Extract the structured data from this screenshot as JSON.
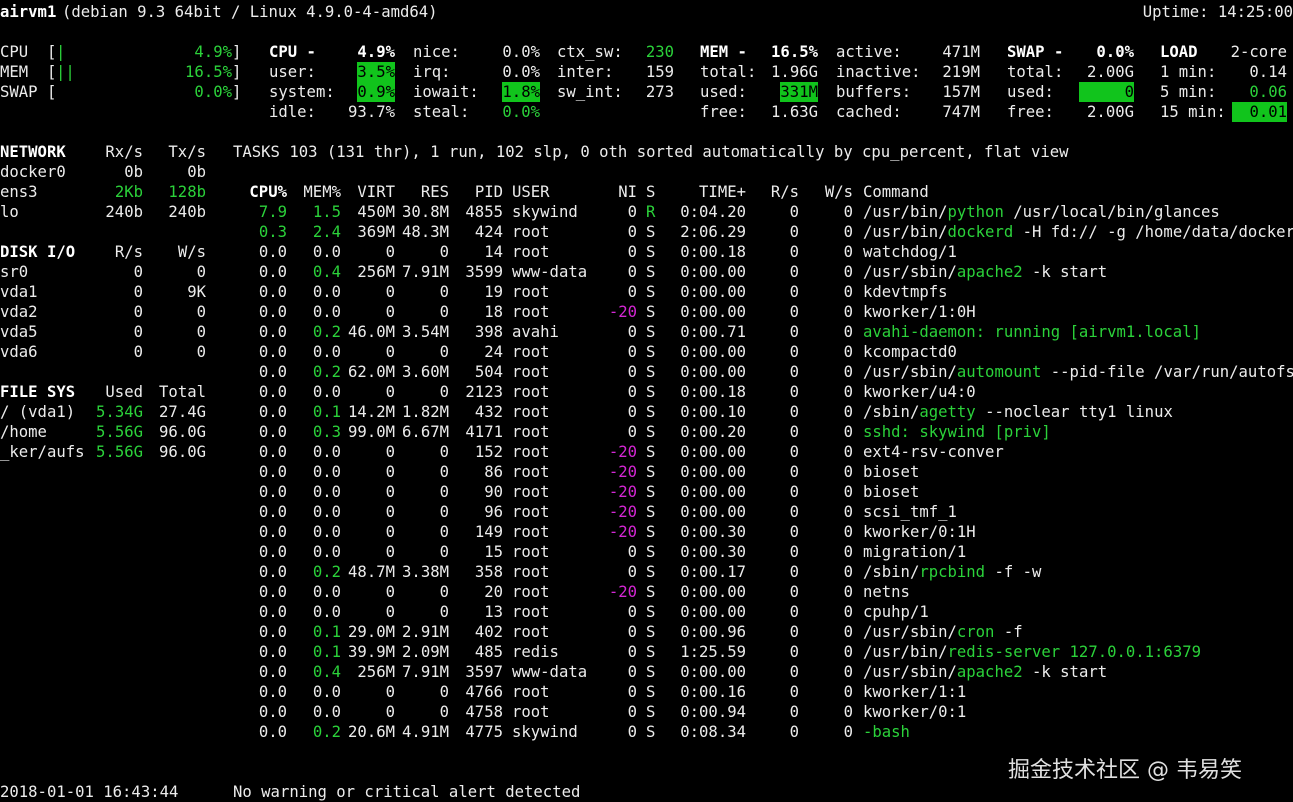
{
  "header": {
    "hostname": "airvm1",
    "system": "(debian 9.3 64bit / Linux 4.9.0-4-amd64)",
    "uptime": "Uptime: 14:25:00"
  },
  "quicklook": {
    "rows": [
      {
        "label": "CPU",
        "bar": "[|",
        "value": "4.9%]",
        "style": "g"
      },
      {
        "label": "MEM",
        "bar": "[||",
        "value": "16.5%]",
        "style": "g"
      },
      {
        "label": "SWAP",
        "bar": "[",
        "value": "0.0%]",
        "style": "g"
      }
    ]
  },
  "cpu": {
    "header_label": "CPU -",
    "header_value": "4.9%",
    "rows": [
      [
        {
          "label": "user:",
          "value": "3.5%",
          "style": "gb"
        },
        {
          "label": "irq:",
          "value": "0.0%",
          "style": ""
        },
        {
          "label": "inter:",
          "value": "159",
          "style": ""
        }
      ],
      [
        {
          "label": "system:",
          "value": "0.9%",
          "style": "gb"
        },
        {
          "label": "iowait:",
          "value": "1.8%",
          "style": "gb"
        },
        {
          "label": "sw_int:",
          "value": "273",
          "style": ""
        }
      ],
      [
        {
          "label": "idle:",
          "value": "93.7%",
          "style": ""
        },
        {
          "label": "steal:",
          "value": "0.0%",
          "style": "g"
        },
        {
          "label": "",
          "value": "",
          "style": ""
        }
      ]
    ],
    "nice_label": "nice:",
    "nice_value": "0.0%",
    "ctx_label": "ctx_sw:",
    "ctx_value": "230"
  },
  "mem": {
    "header_label": "MEM -",
    "header_value": "16.5%",
    "rows": [
      {
        "label": "total:",
        "value": "1.96G",
        "style": ""
      },
      {
        "label": "used:",
        "value": "331M",
        "style": "gb"
      },
      {
        "label": "free:",
        "value": "1.63G",
        "style": ""
      }
    ],
    "right": [
      {
        "label": "active:",
        "value": "471M",
        "style": ""
      },
      {
        "label": "inactive:",
        "value": "219M",
        "style": ""
      },
      {
        "label": "buffers:",
        "value": "157M",
        "style": ""
      },
      {
        "label": "cached:",
        "value": "747M",
        "style": ""
      }
    ]
  },
  "swap": {
    "header_label": "SWAP -",
    "header_value": "0.0%",
    "rows": [
      {
        "label": "total:",
        "value": "2.00G",
        "style": ""
      },
      {
        "label": "used:",
        "value": "0",
        "style": "gb"
      },
      {
        "label": "free:",
        "value": "2.00G",
        "style": ""
      }
    ]
  },
  "load": {
    "header_label": "LOAD",
    "header_value": "2-core",
    "rows": [
      {
        "label": "1 min:",
        "value": "0.14",
        "style": ""
      },
      {
        "label": "5 min:",
        "value": "0.06",
        "style": "g"
      },
      {
        "label": "15 min:",
        "value": "0.01",
        "style": "gb"
      }
    ]
  },
  "network": {
    "title": "NETWORK",
    "col1": "Rx/s",
    "col2": "Tx/s",
    "rows": [
      {
        "name": "docker0",
        "rx": "0b",
        "tx": "0b",
        "style": ""
      },
      {
        "name": "ens3",
        "rx": "2Kb",
        "tx": "128b",
        "style": "g"
      },
      {
        "name": "lo",
        "rx": "240b",
        "tx": "240b",
        "style": ""
      }
    ]
  },
  "disk": {
    "title": "DISK I/O",
    "col1": "R/s",
    "col2": "W/s",
    "rows": [
      {
        "name": "sr0",
        "r": "0",
        "w": "0"
      },
      {
        "name": "vda1",
        "r": "0",
        "w": "9K"
      },
      {
        "name": "vda2",
        "r": "0",
        "w": "0"
      },
      {
        "name": "vda5",
        "r": "0",
        "w": "0"
      },
      {
        "name": "vda6",
        "r": "0",
        "w": "0"
      }
    ]
  },
  "fs": {
    "title": "FILE SYS",
    "col1": "Used",
    "col2": "Total",
    "rows": [
      {
        "name": "/ (vda1)",
        "used": "5.34G",
        "total": "27.4G"
      },
      {
        "name": "/home",
        "used": "5.56G",
        "total": "96.0G"
      },
      {
        "name": "_ker/aufs",
        "used": "5.56G",
        "total": "96.0G"
      }
    ]
  },
  "tasks": {
    "summary": "TASKS 103 (131 thr), 1 run, 102 slp, 0 oth sorted automatically by cpu_percent, flat view"
  },
  "proc_headers": {
    "cpu": "CPU%",
    "mem": "MEM%",
    "virt": "VIRT",
    "res": "RES",
    "pid": "PID",
    "user": "USER",
    "ni": "NI",
    "s": "S",
    "time": "TIME+",
    "rs": "R/s",
    "ws": "W/s",
    "cmd": "Command"
  },
  "processes": [
    {
      "cpu": "7.9",
      "mem": "1.5",
      "virt": "450M",
      "res": "30.8M",
      "pid": "4855",
      "user": "skywind",
      "ni": "0",
      "s": "R",
      "time": "0:04.20",
      "rs": "0",
      "ws": "0",
      "cmd": [
        {
          "t": "/usr/bin/"
        },
        {
          "t": "python",
          "c": "g"
        },
        {
          "t": " /usr/local/bin/glances"
        }
      ],
      "cpuc": "g",
      "memc": "g",
      "nic": "",
      "sc": "g"
    },
    {
      "cpu": "0.3",
      "mem": "2.4",
      "virt": "369M",
      "res": "48.3M",
      "pid": "424",
      "user": "root",
      "ni": "0",
      "s": "S",
      "time": "2:06.29",
      "rs": "0",
      "ws": "0",
      "cmd": [
        {
          "t": "/usr/bin/"
        },
        {
          "t": "dockerd",
          "c": "g"
        },
        {
          "t": " -H fd:// -g /home/data/docker"
        }
      ],
      "cpuc": "g",
      "memc": "g",
      "nic": "",
      "sc": ""
    },
    {
      "cpu": "0.0",
      "mem": "0.0",
      "virt": "0",
      "res": "0",
      "pid": "14",
      "user": "root",
      "ni": "0",
      "s": "S",
      "time": "0:00.18",
      "rs": "0",
      "ws": "0",
      "cmd": [
        {
          "t": "watchdog/1"
        }
      ],
      "cpuc": "",
      "memc": "",
      "nic": "",
      "sc": ""
    },
    {
      "cpu": "0.0",
      "mem": "0.4",
      "virt": "256M",
      "res": "7.91M",
      "pid": "3599",
      "user": "www-data",
      "ni": "0",
      "s": "S",
      "time": "0:00.00",
      "rs": "0",
      "ws": "0",
      "cmd": [
        {
          "t": "/usr/sbin/"
        },
        {
          "t": "apache2",
          "c": "g"
        },
        {
          "t": " -k start"
        }
      ],
      "cpuc": "",
      "memc": "g",
      "nic": "",
      "sc": ""
    },
    {
      "cpu": "0.0",
      "mem": "0.0",
      "virt": "0",
      "res": "0",
      "pid": "19",
      "user": "root",
      "ni": "0",
      "s": "S",
      "time": "0:00.00",
      "rs": "0",
      "ws": "0",
      "cmd": [
        {
          "t": "kdevtmpfs"
        }
      ],
      "cpuc": "",
      "memc": "",
      "nic": "",
      "sc": ""
    },
    {
      "cpu": "0.0",
      "mem": "0.0",
      "virt": "0",
      "res": "0",
      "pid": "18",
      "user": "root",
      "ni": "-20",
      "s": "S",
      "time": "0:00.00",
      "rs": "0",
      "ws": "0",
      "cmd": [
        {
          "t": "kworker/1:0H"
        }
      ],
      "cpuc": "",
      "memc": "",
      "nic": "m",
      "sc": ""
    },
    {
      "cpu": "0.0",
      "mem": "0.2",
      "virt": "46.0M",
      "res": "3.54M",
      "pid": "398",
      "user": "avahi",
      "ni": "0",
      "s": "S",
      "time": "0:00.71",
      "rs": "0",
      "ws": "0",
      "cmd": [
        {
          "t": "avahi-daemon: running [airvm1.local]",
          "c": "g"
        }
      ],
      "cpuc": "",
      "memc": "g",
      "nic": "",
      "sc": ""
    },
    {
      "cpu": "0.0",
      "mem": "0.0",
      "virt": "0",
      "res": "0",
      "pid": "24",
      "user": "root",
      "ni": "0",
      "s": "S",
      "time": "0:00.00",
      "rs": "0",
      "ws": "0",
      "cmd": [
        {
          "t": "kcompactd0"
        }
      ],
      "cpuc": "",
      "memc": "",
      "nic": "",
      "sc": ""
    },
    {
      "cpu": "0.0",
      "mem": "0.2",
      "virt": "62.0M",
      "res": "3.60M",
      "pid": "504",
      "user": "root",
      "ni": "0",
      "s": "S",
      "time": "0:00.00",
      "rs": "0",
      "ws": "0",
      "cmd": [
        {
          "t": "/usr/sbin/"
        },
        {
          "t": "automount",
          "c": "g"
        },
        {
          "t": " --pid-file /var/run/autofs.p"
        }
      ],
      "cpuc": "",
      "memc": "g",
      "nic": "",
      "sc": ""
    },
    {
      "cpu": "0.0",
      "mem": "0.0",
      "virt": "0",
      "res": "0",
      "pid": "2123",
      "user": "root",
      "ni": "0",
      "s": "S",
      "time": "0:00.18",
      "rs": "0",
      "ws": "0",
      "cmd": [
        {
          "t": "kworker/u4:0"
        }
      ],
      "cpuc": "",
      "memc": "",
      "nic": "",
      "sc": ""
    },
    {
      "cpu": "0.0",
      "mem": "0.1",
      "virt": "14.2M",
      "res": "1.82M",
      "pid": "432",
      "user": "root",
      "ni": "0",
      "s": "S",
      "time": "0:00.10",
      "rs": "0",
      "ws": "0",
      "cmd": [
        {
          "t": "/sbin/"
        },
        {
          "t": "agetty",
          "c": "g"
        },
        {
          "t": " --noclear tty1 linux"
        }
      ],
      "cpuc": "",
      "memc": "g",
      "nic": "",
      "sc": ""
    },
    {
      "cpu": "0.0",
      "mem": "0.3",
      "virt": "99.0M",
      "res": "6.67M",
      "pid": "4171",
      "user": "root",
      "ni": "0",
      "s": "S",
      "time": "0:00.20",
      "rs": "0",
      "ws": "0",
      "cmd": [
        {
          "t": "sshd: skywind [priv]",
          "c": "g"
        }
      ],
      "cpuc": "",
      "memc": "g",
      "nic": "",
      "sc": ""
    },
    {
      "cpu": "0.0",
      "mem": "0.0",
      "virt": "0",
      "res": "0",
      "pid": "152",
      "user": "root",
      "ni": "-20",
      "s": "S",
      "time": "0:00.00",
      "rs": "0",
      "ws": "0",
      "cmd": [
        {
          "t": "ext4-rsv-conver"
        }
      ],
      "cpuc": "",
      "memc": "",
      "nic": "m",
      "sc": ""
    },
    {
      "cpu": "0.0",
      "mem": "0.0",
      "virt": "0",
      "res": "0",
      "pid": "86",
      "user": "root",
      "ni": "-20",
      "s": "S",
      "time": "0:00.00",
      "rs": "0",
      "ws": "0",
      "cmd": [
        {
          "t": "bioset"
        }
      ],
      "cpuc": "",
      "memc": "",
      "nic": "m",
      "sc": ""
    },
    {
      "cpu": "0.0",
      "mem": "0.0",
      "virt": "0",
      "res": "0",
      "pid": "90",
      "user": "root",
      "ni": "-20",
      "s": "S",
      "time": "0:00.00",
      "rs": "0",
      "ws": "0",
      "cmd": [
        {
          "t": "bioset"
        }
      ],
      "cpuc": "",
      "memc": "",
      "nic": "m",
      "sc": ""
    },
    {
      "cpu": "0.0",
      "mem": "0.0",
      "virt": "0",
      "res": "0",
      "pid": "96",
      "user": "root",
      "ni": "-20",
      "s": "S",
      "time": "0:00.00",
      "rs": "0",
      "ws": "0",
      "cmd": [
        {
          "t": "scsi_tmf_1"
        }
      ],
      "cpuc": "",
      "memc": "",
      "nic": "m",
      "sc": ""
    },
    {
      "cpu": "0.0",
      "mem": "0.0",
      "virt": "0",
      "res": "0",
      "pid": "149",
      "user": "root",
      "ni": "-20",
      "s": "S",
      "time": "0:00.30",
      "rs": "0",
      "ws": "0",
      "cmd": [
        {
          "t": "kworker/0:1H"
        }
      ],
      "cpuc": "",
      "memc": "",
      "nic": "m",
      "sc": ""
    },
    {
      "cpu": "0.0",
      "mem": "0.0",
      "virt": "0",
      "res": "0",
      "pid": "15",
      "user": "root",
      "ni": "0",
      "s": "S",
      "time": "0:00.30",
      "rs": "0",
      "ws": "0",
      "cmd": [
        {
          "t": "migration/1"
        }
      ],
      "cpuc": "",
      "memc": "",
      "nic": "",
      "sc": ""
    },
    {
      "cpu": "0.0",
      "mem": "0.2",
      "virt": "48.7M",
      "res": "3.38M",
      "pid": "358",
      "user": "root",
      "ni": "0",
      "s": "S",
      "time": "0:00.17",
      "rs": "0",
      "ws": "0",
      "cmd": [
        {
          "t": "/sbin/"
        },
        {
          "t": "rpcbind",
          "c": "g"
        },
        {
          "t": " -f -w"
        }
      ],
      "cpuc": "",
      "memc": "g",
      "nic": "",
      "sc": ""
    },
    {
      "cpu": "0.0",
      "mem": "0.0",
      "virt": "0",
      "res": "0",
      "pid": "20",
      "user": "root",
      "ni": "-20",
      "s": "S",
      "time": "0:00.00",
      "rs": "0",
      "ws": "0",
      "cmd": [
        {
          "t": "netns"
        }
      ],
      "cpuc": "",
      "memc": "",
      "nic": "m",
      "sc": ""
    },
    {
      "cpu": "0.0",
      "mem": "0.0",
      "virt": "0",
      "res": "0",
      "pid": "13",
      "user": "root",
      "ni": "0",
      "s": "S",
      "time": "0:00.00",
      "rs": "0",
      "ws": "0",
      "cmd": [
        {
          "t": "cpuhp/1"
        }
      ],
      "cpuc": "",
      "memc": "",
      "nic": "",
      "sc": ""
    },
    {
      "cpu": "0.0",
      "mem": "0.1",
      "virt": "29.0M",
      "res": "2.91M",
      "pid": "402",
      "user": "root",
      "ni": "0",
      "s": "S",
      "time": "0:00.96",
      "rs": "0",
      "ws": "0",
      "cmd": [
        {
          "t": "/usr/sbin/"
        },
        {
          "t": "cron",
          "c": "g"
        },
        {
          "t": " -f"
        }
      ],
      "cpuc": "",
      "memc": "g",
      "nic": "",
      "sc": ""
    },
    {
      "cpu": "0.0",
      "mem": "0.1",
      "virt": "39.9M",
      "res": "2.09M",
      "pid": "485",
      "user": "redis",
      "ni": "0",
      "s": "S",
      "time": "1:25.59",
      "rs": "0",
      "ws": "0",
      "cmd": [
        {
          "t": "/usr/bin/"
        },
        {
          "t": "redis-server 127.0.0.1:6379",
          "c": "g"
        }
      ],
      "cpuc": "",
      "memc": "g",
      "nic": "",
      "sc": ""
    },
    {
      "cpu": "0.0",
      "mem": "0.4",
      "virt": "256M",
      "res": "7.91M",
      "pid": "3597",
      "user": "www-data",
      "ni": "0",
      "s": "S",
      "time": "0:00.00",
      "rs": "0",
      "ws": "0",
      "cmd": [
        {
          "t": "/usr/sbin/"
        },
        {
          "t": "apache2",
          "c": "g"
        },
        {
          "t": " -k start"
        }
      ],
      "cpuc": "",
      "memc": "g",
      "nic": "",
      "sc": ""
    },
    {
      "cpu": "0.0",
      "mem": "0.0",
      "virt": "0",
      "res": "0",
      "pid": "4766",
      "user": "root",
      "ni": "0",
      "s": "S",
      "time": "0:00.16",
      "rs": "0",
      "ws": "0",
      "cmd": [
        {
          "t": "kworker/1:1"
        }
      ],
      "cpuc": "",
      "memc": "",
      "nic": "",
      "sc": ""
    },
    {
      "cpu": "0.0",
      "mem": "0.0",
      "virt": "0",
      "res": "0",
      "pid": "4758",
      "user": "root",
      "ni": "0",
      "s": "S",
      "time": "0:00.94",
      "rs": "0",
      "ws": "0",
      "cmd": [
        {
          "t": "kworker/0:1"
        }
      ],
      "cpuc": "",
      "memc": "",
      "nic": "",
      "sc": ""
    },
    {
      "cpu": "0.0",
      "mem": "0.2",
      "virt": "20.6M",
      "res": "4.91M",
      "pid": "4775",
      "user": "skywind",
      "ni": "0",
      "s": "S",
      "time": "0:08.34",
      "rs": "0",
      "ws": "0",
      "cmd": [
        {
          "t": "-bash",
          "c": "g"
        }
      ],
      "cpuc": "",
      "memc": "g",
      "nic": "",
      "sc": ""
    }
  ],
  "footer": {
    "datetime": "2018-01-01 16:43:44",
    "alert": "No warning or critical alert detected"
  },
  "watermark": "掘金技术社区 @ 韦易笑",
  "colors": {
    "green": "#2bd23a",
    "green_bg": "#11c41c",
    "magenta": "#d427d4",
    "bg": "#000000",
    "text": "#ececec"
  }
}
